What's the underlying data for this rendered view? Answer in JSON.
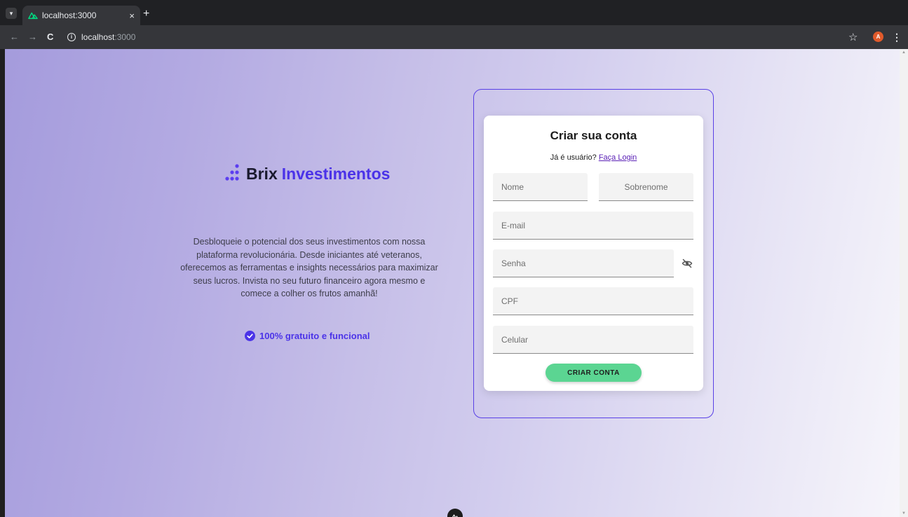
{
  "browser": {
    "tab_title": "localhost:3000",
    "tab_close": "×",
    "new_tab": "+",
    "url_host": "localhost",
    "url_port": ":3000",
    "nav_back": "←",
    "nav_forward": "→",
    "nav_reload": "C",
    "profile_initial": "A",
    "colors": {
      "chrome_dark": "#202124",
      "chrome_toolbar": "#35363a",
      "favicon": "#00dc82",
      "avatar": "#e05a2b"
    }
  },
  "brand": {
    "name_part1": "Brix",
    "name_part2": "Investimentos",
    "colors": {
      "dark": "#1a1a2e",
      "accent": "#4b33e8"
    }
  },
  "hero": {
    "description": "Desbloqueie o potencial dos seus investimentos com nossa plataforma revolucionária. Desde iniciantes até veteranos, oferecemos as ferramentas e insights necessários para maximizar seus lucros. Invista no seu futuro financeiro agora mesmo e comece a colher os frutos amanhã!",
    "badge_text": "100% gratuito e funcional",
    "badge_icon": "check-circle-icon"
  },
  "form": {
    "title": "Criar sua conta",
    "login_prompt": "Já é usuário?",
    "login_link": "Faça Login",
    "fields": {
      "first_name": {
        "placeholder": "Nome",
        "value": ""
      },
      "last_name": {
        "placeholder": "Sobrenome",
        "value": ""
      },
      "email": {
        "placeholder": "E-mail",
        "value": ""
      },
      "password": {
        "placeholder": "Senha",
        "value": ""
      },
      "cpf": {
        "placeholder": "CPF",
        "value": ""
      },
      "phone": {
        "placeholder": "Celular",
        "value": ""
      }
    },
    "password_toggle_icon": "eye-off-icon",
    "submit_label": "CRIAR CONTA",
    "colors": {
      "frame": "#5940e6",
      "submit": "#5bd592",
      "link": "#5b21b6"
    }
  }
}
